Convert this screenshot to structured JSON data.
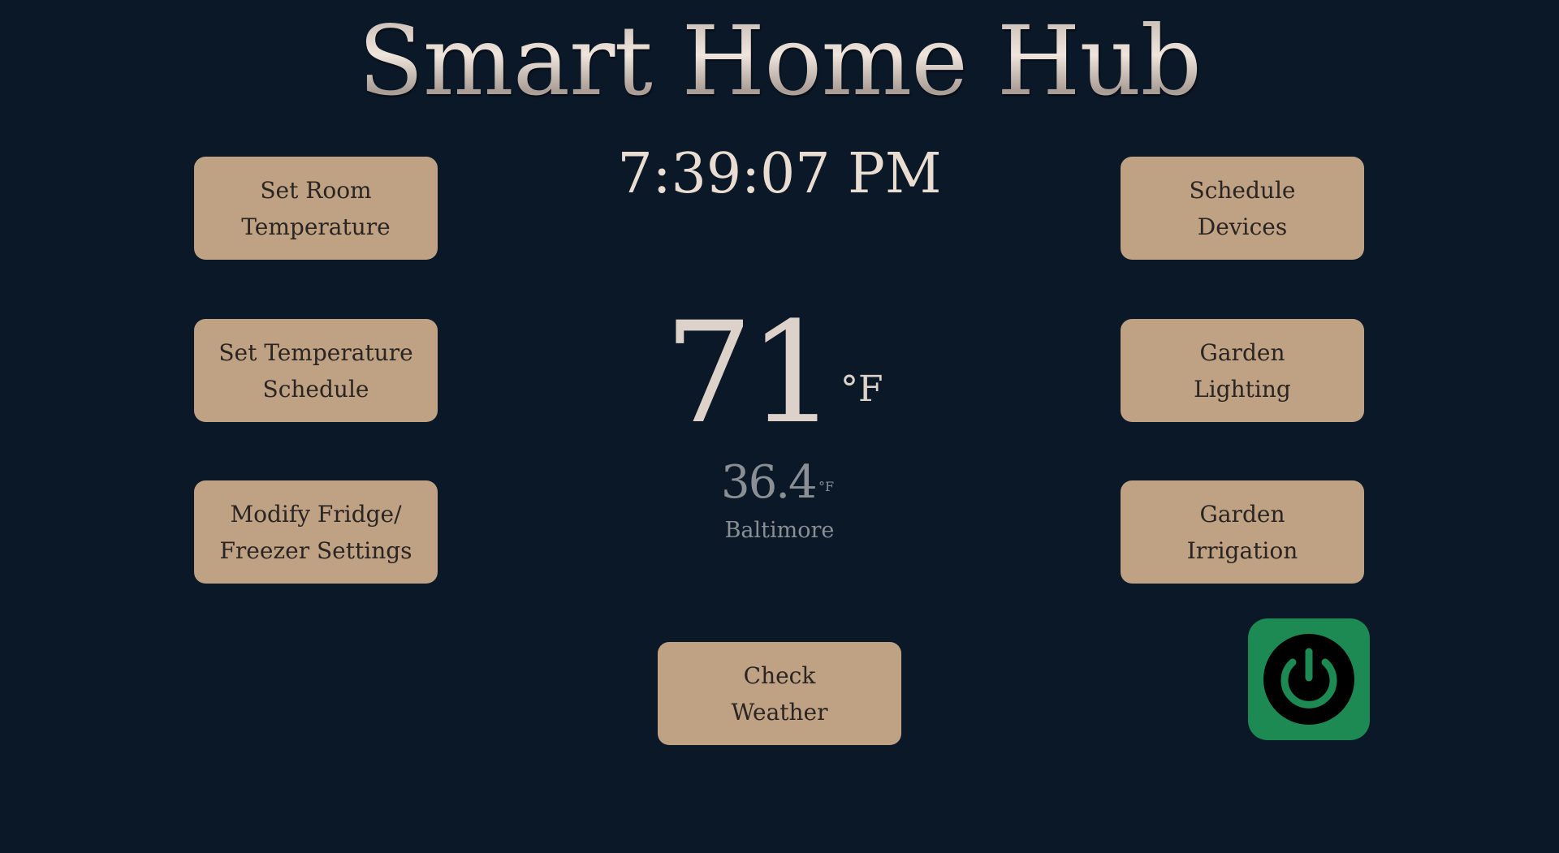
{
  "app": {
    "title": "Smart Home Hub",
    "clock": "7:39:07 PM"
  },
  "left_buttons": [
    {
      "label": "Set Room Temperature"
    },
    {
      "label": "Set Temperature Schedule"
    },
    {
      "label": "Modify Fridge/ Freezer Settings"
    }
  ],
  "right_buttons": [
    {
      "label": "Schedule Devices"
    },
    {
      "label": "Garden Lighting"
    },
    {
      "label": "Garden Irrigation"
    }
  ],
  "center_button": {
    "label": "Check Weather"
  },
  "indoor": {
    "temperature": "71",
    "unit": "°F"
  },
  "outdoor": {
    "temperature": "36.4",
    "unit": "°F",
    "city": "Baltimore"
  },
  "power_button": {
    "icon": "power-icon",
    "state": "on"
  },
  "colors": {
    "background": "#0b1828",
    "button": "#bfa183",
    "button_text": "#2a2522",
    "power_bg": "#1c8a52",
    "power_icon": "#000000",
    "primary_text": "#e9ddd2",
    "muted_text": "#8a8f94"
  }
}
